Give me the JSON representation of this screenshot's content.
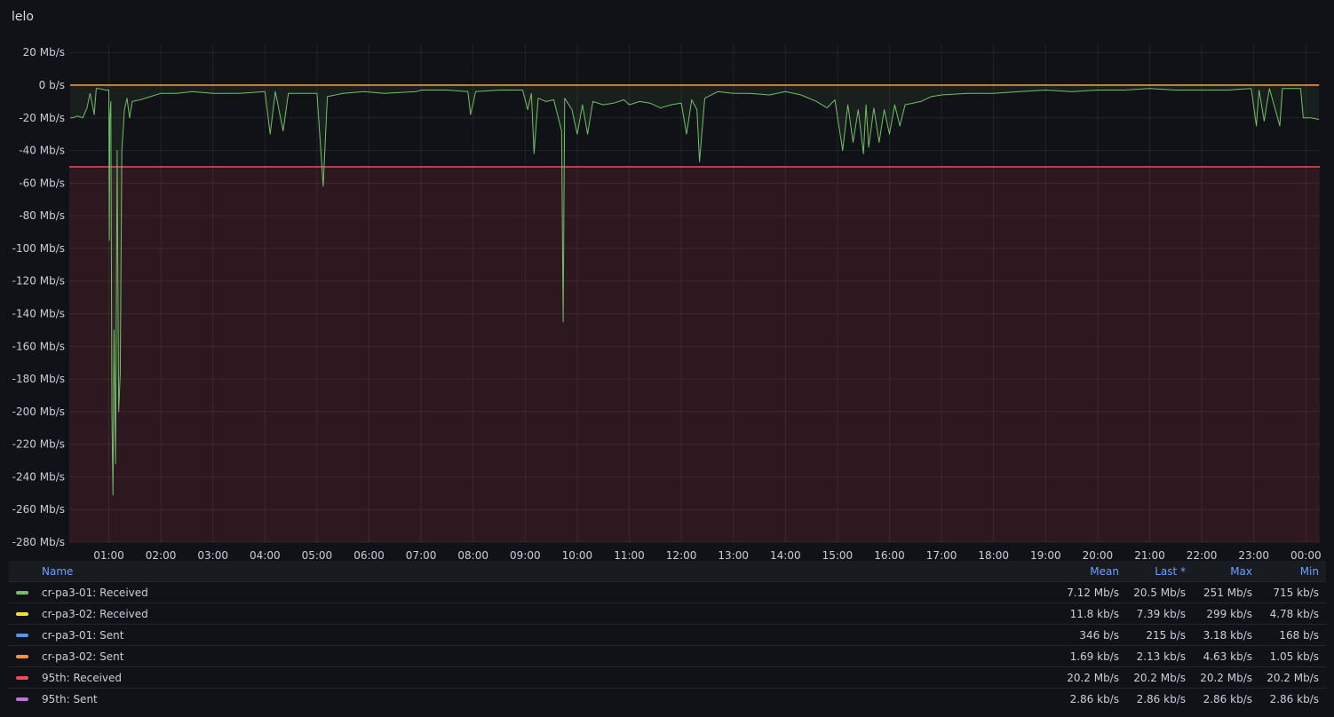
{
  "panel": {
    "title": "lelo"
  },
  "chart_data": {
    "type": "line",
    "title": "lelo",
    "y_unit": "Mb/s",
    "ylim": [
      -280,
      20
    ],
    "y_ticks": [
      {
        "value": 20,
        "label": "20 Mb/s"
      },
      {
        "value": 0,
        "label": "0 b/s"
      },
      {
        "value": -20,
        "label": "-20 Mb/s"
      },
      {
        "value": -40,
        "label": "-40 Mb/s"
      },
      {
        "value": -60,
        "label": "-60 Mb/s"
      },
      {
        "value": -80,
        "label": "-80 Mb/s"
      },
      {
        "value": -100,
        "label": "-100 Mb/s"
      },
      {
        "value": -120,
        "label": "-120 Mb/s"
      },
      {
        "value": -140,
        "label": "-140 Mb/s"
      },
      {
        "value": -160,
        "label": "-160 Mb/s"
      },
      {
        "value": -180,
        "label": "-180 Mb/s"
      },
      {
        "value": -200,
        "label": "-200 Mb/s"
      },
      {
        "value": -220,
        "label": "-220 Mb/s"
      },
      {
        "value": -240,
        "label": "-240 Mb/s"
      },
      {
        "value": -260,
        "label": "-260 Mb/s"
      },
      {
        "value": -280,
        "label": "-280 Mb/s"
      }
    ],
    "x_ticks": [
      "01:00",
      "02:00",
      "03:00",
      "04:00",
      "05:00",
      "06:00",
      "07:00",
      "08:00",
      "09:00",
      "10:00",
      "11:00",
      "12:00",
      "13:00",
      "14:00",
      "15:00",
      "16:00",
      "17:00",
      "18:00",
      "19:00",
      "20:00",
      "21:00",
      "22:00",
      "23:00",
      "00:00"
    ],
    "threshold": {
      "value": -50,
      "color": "#f2495c"
    },
    "grid": true,
    "legend_placement": "bottom",
    "series": [
      {
        "name": "cr-pa3-01: Received",
        "color": "#73bf69",
        "points": [
          [
            0.26,
            -20
          ],
          [
            0.3,
            -20
          ],
          [
            0.4,
            -19
          ],
          [
            0.5,
            -20
          ],
          [
            0.58,
            -14
          ],
          [
            0.64,
            -5
          ],
          [
            0.72,
            -18
          ],
          [
            0.76,
            -2
          ],
          [
            0.8,
            -2
          ],
          [
            0.95,
            -3
          ],
          [
            1.0,
            -3
          ],
          [
            1.01,
            -95
          ],
          [
            1.02,
            -20
          ],
          [
            1.04,
            -10
          ],
          [
            1.06,
            -200
          ],
          [
            1.08,
            -251
          ],
          [
            1.1,
            -150
          ],
          [
            1.13,
            -232
          ],
          [
            1.16,
            -40
          ],
          [
            1.19,
            -200
          ],
          [
            1.22,
            -177
          ],
          [
            1.25,
            -40
          ],
          [
            1.3,
            -15
          ],
          [
            1.35,
            -8
          ],
          [
            1.4,
            -20
          ],
          [
            1.45,
            -10
          ],
          [
            1.6,
            -9
          ],
          [
            1.8,
            -7
          ],
          [
            2.0,
            -5
          ],
          [
            2.3,
            -5
          ],
          [
            2.6,
            -4
          ],
          [
            3.0,
            -5
          ],
          [
            3.5,
            -5
          ],
          [
            4.0,
            -4
          ],
          [
            4.1,
            -30
          ],
          [
            4.2,
            -4
          ],
          [
            4.35,
            -28
          ],
          [
            4.45,
            -5
          ],
          [
            4.8,
            -5
          ],
          [
            5.0,
            -5
          ],
          [
            5.12,
            -62
          ],
          [
            5.2,
            -7
          ],
          [
            5.5,
            -5
          ],
          [
            5.9,
            -4
          ],
          [
            6.3,
            -5
          ],
          [
            6.9,
            -4
          ],
          [
            7.0,
            -3
          ],
          [
            7.5,
            -3
          ],
          [
            7.9,
            -4
          ],
          [
            7.95,
            -18
          ],
          [
            8.05,
            -4
          ],
          [
            8.5,
            -3
          ],
          [
            8.95,
            -3
          ],
          [
            9.05,
            -15
          ],
          [
            9.12,
            -5
          ],
          [
            9.17,
            -42
          ],
          [
            9.25,
            -8
          ],
          [
            9.4,
            -10
          ],
          [
            9.55,
            -9
          ],
          [
            9.7,
            -28
          ],
          [
            9.73,
            -145
          ],
          [
            9.76,
            -8
          ],
          [
            9.9,
            -15
          ],
          [
            10.0,
            -30
          ],
          [
            10.1,
            -12
          ],
          [
            10.2,
            -30
          ],
          [
            10.3,
            -10
          ],
          [
            10.5,
            -12
          ],
          [
            10.7,
            -11
          ],
          [
            10.9,
            -9
          ],
          [
            11.0,
            -12
          ],
          [
            11.2,
            -10
          ],
          [
            11.4,
            -11
          ],
          [
            11.6,
            -14
          ],
          [
            11.8,
            -12
          ],
          [
            12.0,
            -11
          ],
          [
            12.1,
            -30
          ],
          [
            12.2,
            -9
          ],
          [
            12.3,
            -15
          ],
          [
            12.35,
            -47
          ],
          [
            12.45,
            -8
          ],
          [
            12.7,
            -4
          ],
          [
            13.0,
            -5
          ],
          [
            13.3,
            -5
          ],
          [
            13.7,
            -6
          ],
          [
            14.0,
            -4
          ],
          [
            14.3,
            -6
          ],
          [
            14.6,
            -10
          ],
          [
            14.8,
            -14
          ],
          [
            14.95,
            -9
          ],
          [
            15.1,
            -40
          ],
          [
            15.2,
            -12
          ],
          [
            15.3,
            -35
          ],
          [
            15.4,
            -15
          ],
          [
            15.5,
            -42
          ],
          [
            15.55,
            -12
          ],
          [
            15.6,
            -38
          ],
          [
            15.7,
            -14
          ],
          [
            15.8,
            -35
          ],
          [
            15.9,
            -15
          ],
          [
            16.0,
            -30
          ],
          [
            16.1,
            -12
          ],
          [
            16.2,
            -25
          ],
          [
            16.3,
            -12
          ],
          [
            16.6,
            -10
          ],
          [
            16.8,
            -7
          ],
          [
            17.0,
            -6
          ],
          [
            17.5,
            -5
          ],
          [
            18.0,
            -5
          ],
          [
            18.5,
            -4
          ],
          [
            19.0,
            -3
          ],
          [
            19.5,
            -4
          ],
          [
            20.0,
            -3
          ],
          [
            20.5,
            -3
          ],
          [
            21.0,
            -2
          ],
          [
            21.5,
            -3
          ],
          [
            22.0,
            -3
          ],
          [
            22.5,
            -3
          ],
          [
            22.95,
            -2
          ],
          [
            23.05,
            -25
          ],
          [
            23.1,
            -3
          ],
          [
            23.2,
            -22
          ],
          [
            23.3,
            -2
          ],
          [
            23.5,
            -25
          ],
          [
            23.55,
            -2
          ],
          [
            23.9,
            -2
          ],
          [
            23.95,
            -20
          ],
          [
            24.1,
            -20
          ],
          [
            24.25,
            -21
          ]
        ]
      },
      {
        "name": "cr-pa3-02: Received",
        "color": "#fade2a",
        "points": [
          [
            0.26,
            0.02
          ],
          [
            24.25,
            0.02
          ]
        ]
      },
      {
        "name": "cr-pa3-01: Sent",
        "color": "#5794f2",
        "points": [
          [
            0.26,
            0
          ],
          [
            24.25,
            0
          ]
        ]
      },
      {
        "name": "cr-pa3-02: Sent",
        "color": "#ff9830",
        "points": [
          [
            0.26,
            0
          ],
          [
            24.25,
            0
          ]
        ]
      }
    ],
    "x_domain": [
      0.26,
      24.25
    ]
  },
  "legend": {
    "headers": {
      "name": "Name",
      "mean": "Mean",
      "last": "Last *",
      "max": "Max",
      "min": "Min"
    },
    "rows": [
      {
        "name": "cr-pa3-01: Received",
        "color": "#73bf69",
        "mean": "7.12 Mb/s",
        "last": "20.5 Mb/s",
        "max": "251 Mb/s",
        "min": "715 kb/s"
      },
      {
        "name": "cr-pa3-02: Received",
        "color": "#fade2a",
        "mean": "11.8 kb/s",
        "last": "7.39 kb/s",
        "max": "299 kb/s",
        "min": "4.78 kb/s"
      },
      {
        "name": "cr-pa3-01: Sent",
        "color": "#5794f2",
        "mean": "346 b/s",
        "last": "215 b/s",
        "max": "3.18 kb/s",
        "min": "168 b/s"
      },
      {
        "name": "cr-pa3-02: Sent",
        "color": "#ff9830",
        "mean": "1.69 kb/s",
        "last": "2.13 kb/s",
        "max": "4.63 kb/s",
        "min": "1.05 kb/s"
      },
      {
        "name": "95th: Received",
        "color": "#f2495c",
        "mean": "20.2 Mb/s",
        "last": "20.2 Mb/s",
        "max": "20.2 Mb/s",
        "min": "20.2 Mb/s"
      },
      {
        "name": "95th: Sent",
        "color": "#b877d9",
        "mean": "2.86 kb/s",
        "last": "2.86 kb/s",
        "max": "2.86 kb/s",
        "min": "2.86 kb/s"
      }
    ]
  }
}
